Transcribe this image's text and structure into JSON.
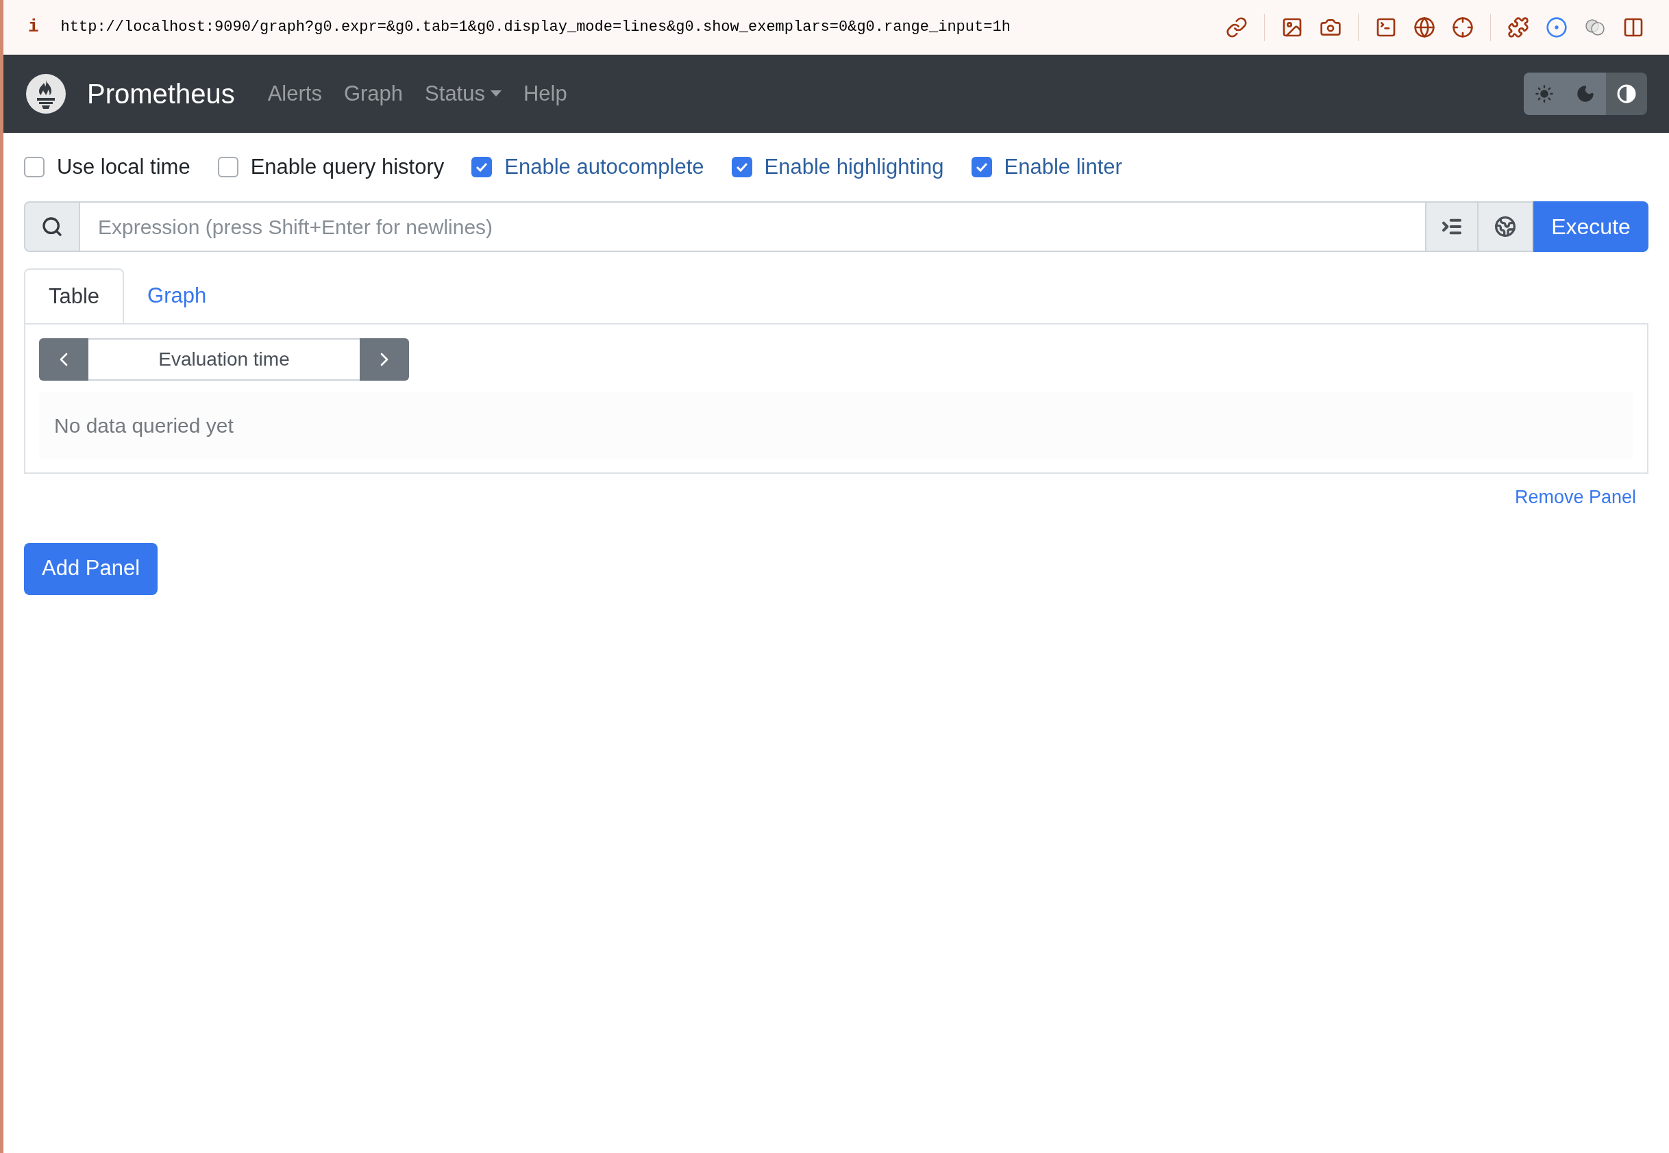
{
  "browser": {
    "info_glyph": "i",
    "url": "http://localhost:9090/graph?g0.expr=&g0.tab=1&g0.display_mode=lines&g0.show_exemplars=0&g0.range_input=1h"
  },
  "navbar": {
    "brand": "Prometheus",
    "items": [
      {
        "label": "Alerts",
        "kind": "link"
      },
      {
        "label": "Graph",
        "kind": "link"
      },
      {
        "label": "Status",
        "kind": "dropdown"
      },
      {
        "label": "Help",
        "kind": "link"
      }
    ],
    "theme_buttons": [
      {
        "kind": "light",
        "selected": false
      },
      {
        "kind": "dark",
        "selected": false
      },
      {
        "kind": "auto",
        "selected": true
      }
    ]
  },
  "options": [
    {
      "label": "Use local time",
      "checked": false
    },
    {
      "label": "Enable query history",
      "checked": false
    },
    {
      "label": "Enable autocomplete",
      "checked": true
    },
    {
      "label": "Enable highlighting",
      "checked": true
    },
    {
      "label": "Enable linter",
      "checked": true
    }
  ],
  "expression": {
    "placeholder": "Expression (press Shift+Enter for newlines)",
    "execute": "Execute"
  },
  "panel": {
    "tabs": [
      {
        "label": "Table",
        "selected": true
      },
      {
        "label": "Graph",
        "selected": false
      }
    ],
    "evaluation_time": {
      "placeholder": "Evaluation time"
    },
    "message": "No data queried yet",
    "remove": "Remove Panel"
  },
  "add_panel": "Add Panel"
}
